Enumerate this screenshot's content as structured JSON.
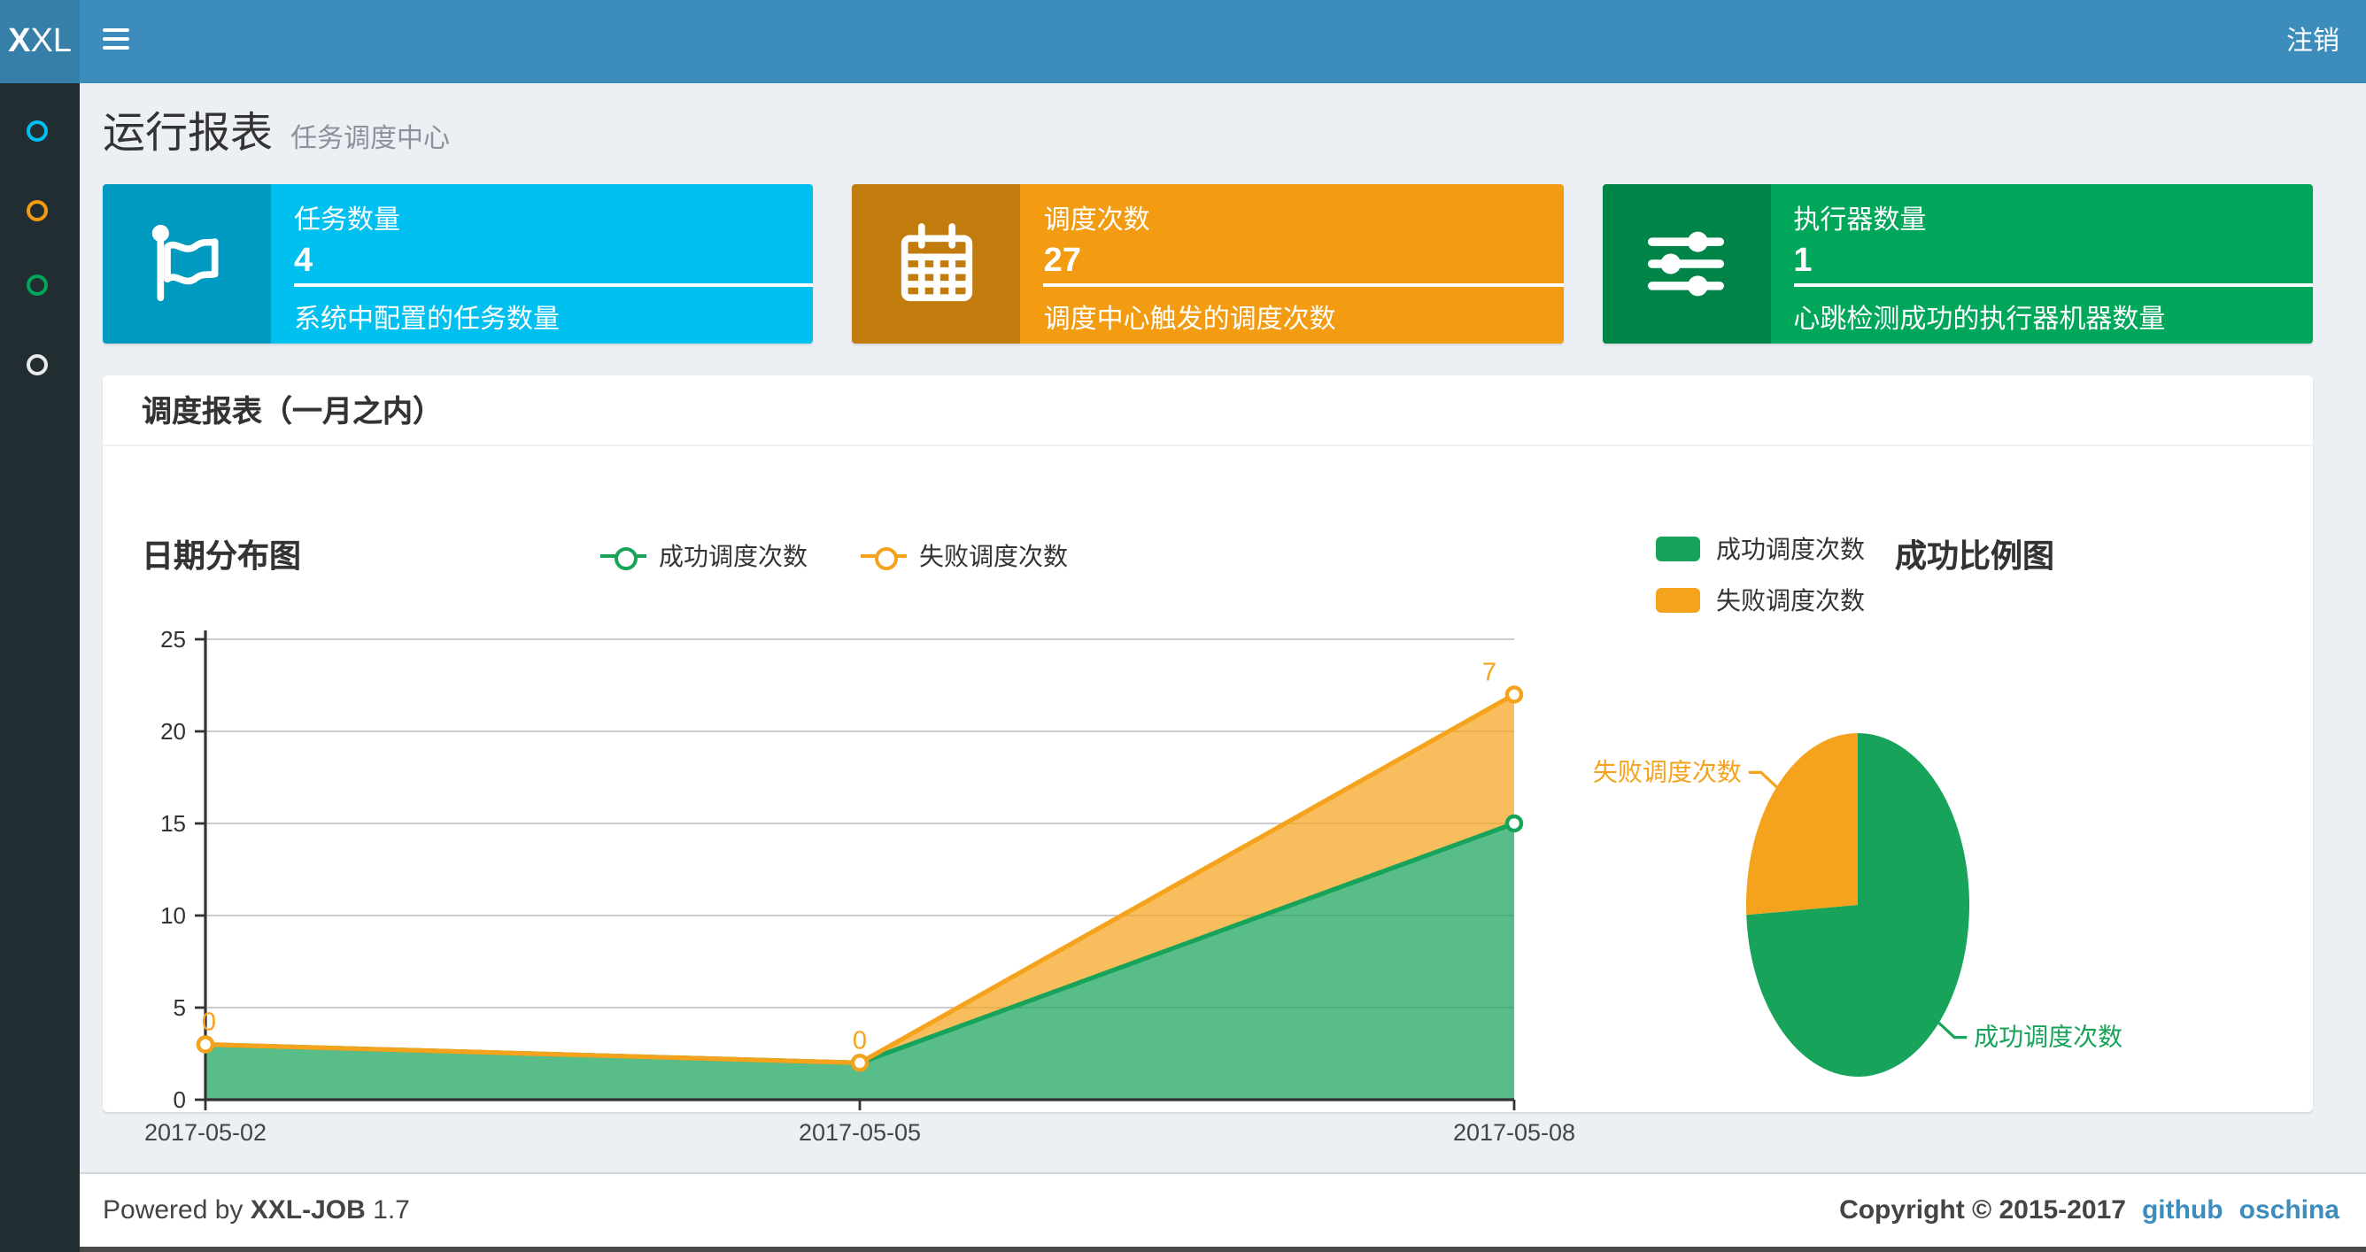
{
  "theme": {
    "navbar_bg": "#3c8dbc",
    "logo_bg": "#367fa9",
    "sidebar_bg": "#222d32",
    "body_bg": "#ecf0f5",
    "success_color": "#17a45a",
    "fail_color": "#f5a31d"
  },
  "navbar": {
    "logo_bold": "X",
    "logo_rest": "XL",
    "logout_label": "注销"
  },
  "sidebar": {
    "items": [
      {
        "name": "menu-dot-1",
        "color": "#00c0ef"
      },
      {
        "name": "menu-dot-2",
        "color": "#f39c12"
      },
      {
        "name": "menu-dot-3",
        "color": "#00a65a"
      },
      {
        "name": "menu-dot-4",
        "color": "#e8eaec"
      }
    ]
  },
  "page": {
    "title": "运行报表",
    "subtitle": "任务调度中心"
  },
  "info_boxes": [
    {
      "icon": "flag-icon",
      "title": "任务数量",
      "value": "4",
      "desc": "系统中配置的任务数量",
      "color": "#00c0ef"
    },
    {
      "icon": "calendar-icon",
      "title": "调度次数",
      "value": "27",
      "desc": "调度中心触发的调度次数",
      "color": "#f39c12"
    },
    {
      "icon": "sliders-icon",
      "title": "执行器数量",
      "value": "1",
      "desc": "心跳检测成功的执行器机器数量",
      "color": "#00a65a"
    }
  ],
  "panel": {
    "title": "调度报表（一月之内）"
  },
  "chart_data": [
    {
      "type": "area",
      "title": "日期分布图",
      "categories": [
        "2017-05-02",
        "2017-05-05",
        "2017-05-08"
      ],
      "stacked": true,
      "series": [
        {
          "name": "成功调度次数",
          "color": "#17a45a",
          "values": [
            3,
            2,
            15
          ]
        },
        {
          "name": "失败调度次数",
          "color": "#f5a31d",
          "values": [
            0,
            0,
            7
          ],
          "labels": [
            "0",
            "0",
            "7"
          ]
        }
      ],
      "ylim": [
        0,
        25
      ],
      "ytick": 5,
      "grid": true,
      "legend_position": "top-center"
    },
    {
      "type": "pie",
      "title": "成功比例图",
      "slices": [
        {
          "name": "成功调度次数",
          "value": 20,
          "color": "#17a45a"
        },
        {
          "name": "失败调度次数",
          "value": 7,
          "color": "#f5a31d"
        }
      ],
      "legend_position": "top-left",
      "start_angle": "top",
      "direction": "clockwise"
    }
  ],
  "footer": {
    "powered_prefix": "Powered by ",
    "brand": "XXL-JOB",
    "version": " 1.7",
    "copyright": "Copyright © 2015-2017",
    "links": [
      {
        "label": "github"
      },
      {
        "label": "oschina"
      }
    ]
  }
}
